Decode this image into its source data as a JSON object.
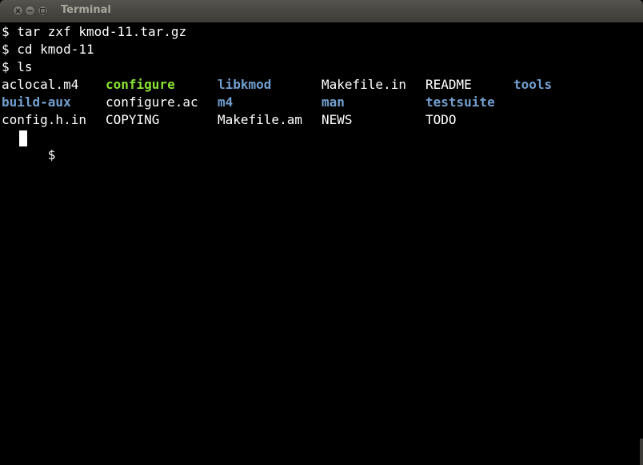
{
  "window": {
    "title": "Terminal"
  },
  "terminal": {
    "commands": [
      "$ tar zxf kmod-11.tar.gz",
      "$ cd kmod-11",
      "$ ls"
    ],
    "ls_rows": [
      [
        {
          "name": "aclocal.m4",
          "type": "file"
        },
        {
          "name": "configure",
          "type": "exec"
        },
        {
          "name": "libkmod",
          "type": "dir"
        },
        {
          "name": "Makefile.in",
          "type": "file"
        },
        {
          "name": "README",
          "type": "file"
        },
        {
          "name": "tools",
          "type": "dir"
        }
      ],
      [
        {
          "name": "build-aux",
          "type": "dir"
        },
        {
          "name": "configure.ac",
          "type": "file"
        },
        {
          "name": "m4",
          "type": "dir"
        },
        {
          "name": "man",
          "type": "dir"
        },
        {
          "name": "testsuite",
          "type": "dir"
        }
      ],
      [
        {
          "name": "config.h.in",
          "type": "file"
        },
        {
          "name": "COPYING",
          "type": "file"
        },
        {
          "name": "Makefile.am",
          "type": "file"
        },
        {
          "name": "NEWS",
          "type": "file"
        },
        {
          "name": "TODO",
          "type": "file"
        }
      ]
    ],
    "prompt": "$",
    "colors": {
      "background": "#000000",
      "foreground": "#ffffff",
      "directory": "#729fcf",
      "executable": "#8ae234"
    }
  }
}
